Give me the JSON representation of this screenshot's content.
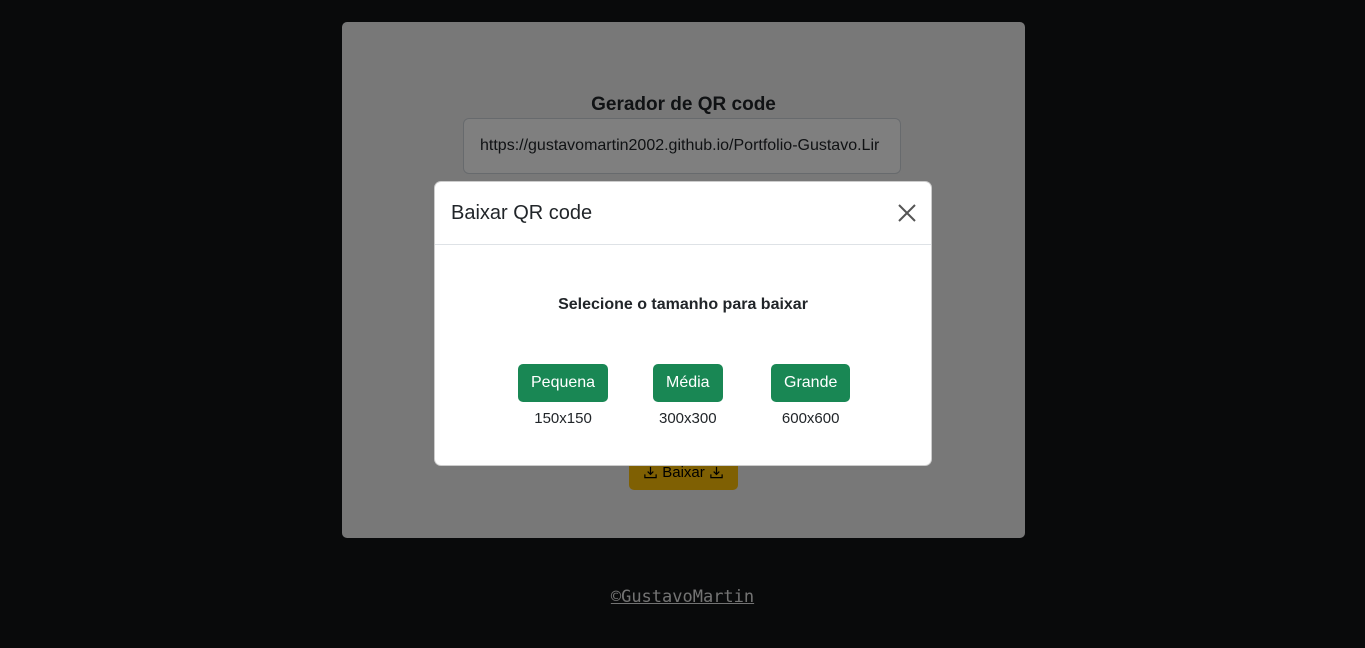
{
  "card": {
    "title": "Gerador de QR code",
    "url_value": "https://gustavomartin2002.github.io/Portfolio-Gustavo.Lir",
    "download_label": "Baixar"
  },
  "footer": {
    "link_text": "©GustavoMartin"
  },
  "modal": {
    "title": "Baixar QR code",
    "prompt": "Selecione o tamanho para baixar",
    "options": [
      {
        "label": "Pequena",
        "size": "150x150"
      },
      {
        "label": "Média",
        "size": "300x300"
      },
      {
        "label": "Grande",
        "size": "600x600"
      }
    ]
  },
  "colors": {
    "background": "#131416",
    "card": "#f1f1f1",
    "size_button": "#198754",
    "download_button": "#ffc107"
  },
  "icons": {
    "close": "close-icon",
    "download": "download-icon"
  }
}
